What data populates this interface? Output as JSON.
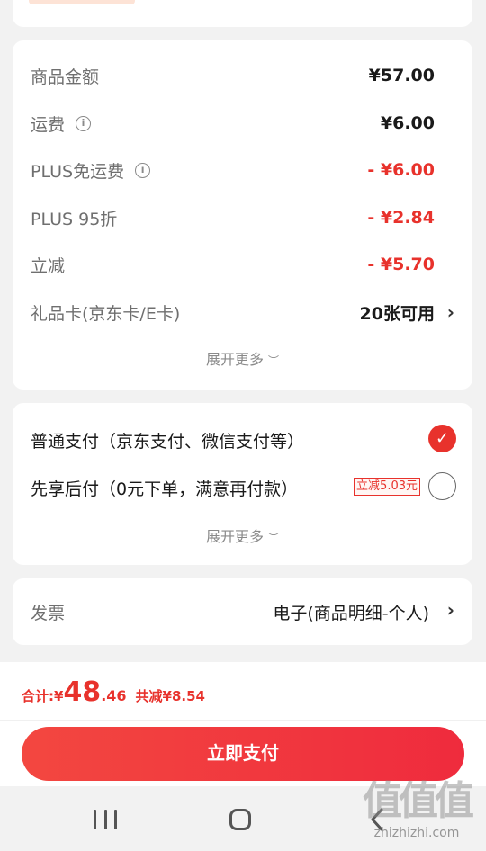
{
  "summary": {
    "rows": [
      {
        "label": "商品金额",
        "value": "¥57.00",
        "info": false,
        "red": false
      },
      {
        "label": "运费",
        "value": "¥6.00",
        "info": true,
        "red": false
      },
      {
        "label": "PLUS免运费",
        "value": "- ¥6.00",
        "info": true,
        "red": true
      },
      {
        "label": "PLUS 95折",
        "value": "- ¥2.84",
        "info": false,
        "red": true
      },
      {
        "label": "立减",
        "value": "- ¥5.70",
        "info": false,
        "red": true
      }
    ],
    "gift_card": {
      "label": "礼品卡(京东卡/E卡)",
      "value": "20张可用"
    },
    "expand_label": "展开更多"
  },
  "payment": {
    "options": [
      {
        "label": "普通支付（京东支付、微信支付等）",
        "selected": true
      },
      {
        "label": "先享后付（0元下单，满意再付款）",
        "selected": false,
        "tag": "立减5.03元"
      }
    ],
    "expand_label": "展开更多"
  },
  "invoice": {
    "label": "发票",
    "value": "电子(商品明细-个人)"
  },
  "total": {
    "prefix": "合计: ",
    "currency": "¥",
    "integer": "48",
    "decimal": ".46",
    "saved": "共减¥8.54"
  },
  "pay_button": "立即支付",
  "watermark": {
    "big": "值值值",
    "small": "zhizhizhi.com"
  },
  "colors": {
    "accent": "#e8322c",
    "background": "#f2f2f2"
  }
}
